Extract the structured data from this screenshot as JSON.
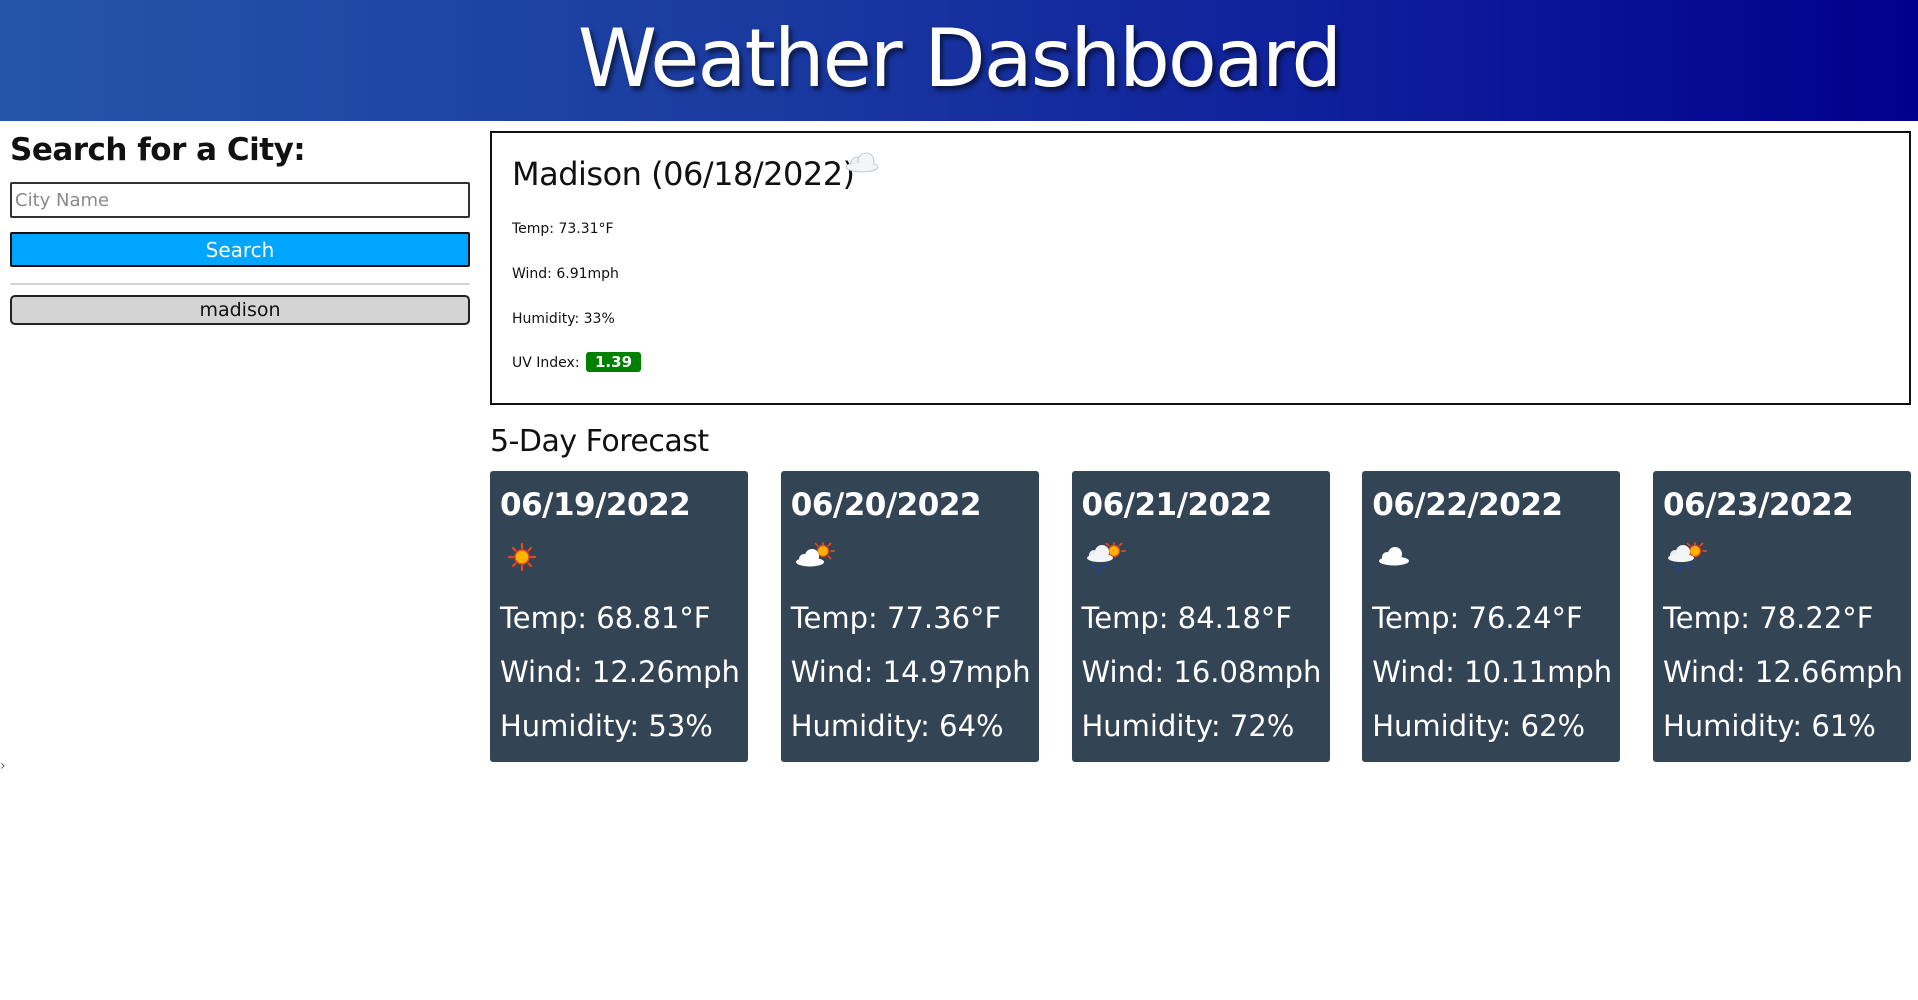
{
  "header": {
    "title": "Weather Dashboard"
  },
  "sidebar": {
    "search_title": "Search for a City:",
    "input_placeholder": "City Name",
    "input_value": "",
    "search_label": "Search",
    "history": [
      {
        "label": "madison"
      }
    ],
    "edge_glyph": "›"
  },
  "current": {
    "heading": "Madison (06/18/2022)",
    "icon": "cloud-icon",
    "temp": "Temp: 73.31°F",
    "wind": "Wind: 6.91mph",
    "humidity": "Humidity: 33%",
    "uv_label": "UV Index:",
    "uv_value": "1.39",
    "uv_color": "#008000"
  },
  "forecast": {
    "title": "5-Day Forecast",
    "days": [
      {
        "date": "06/19/2022",
        "icon": "sun-icon",
        "temp": "Temp: 68.81°F",
        "wind": "Wind: 12.26mph",
        "humidity": "Humidity: 53%"
      },
      {
        "date": "06/20/2022",
        "icon": "partly-cloudy-icon",
        "temp": "Temp: 77.36°F",
        "wind": "Wind: 14.97mph",
        "humidity": "Humidity: 64%"
      },
      {
        "date": "06/21/2022",
        "icon": "rain-sun-icon",
        "temp": "Temp: 84.18°F",
        "wind": "Wind: 16.08mph",
        "humidity": "Humidity: 72%"
      },
      {
        "date": "06/22/2022",
        "icon": "cloud-icon",
        "temp": "Temp: 76.24°F",
        "wind": "Wind: 10.11mph",
        "humidity": "Humidity: 62%"
      },
      {
        "date": "06/23/2022",
        "icon": "rain-sun-icon",
        "temp": "Temp: 78.22°F",
        "wind": "Wind: 12.66mph",
        "humidity": "Humidity: 61%"
      }
    ]
  },
  "colors": {
    "header_gradient_start": "#2456a8",
    "header_gradient_end": "#00008c",
    "search_button": "#00a5ff",
    "card_background": "#334455",
    "history_button": "#d4d4d4"
  }
}
